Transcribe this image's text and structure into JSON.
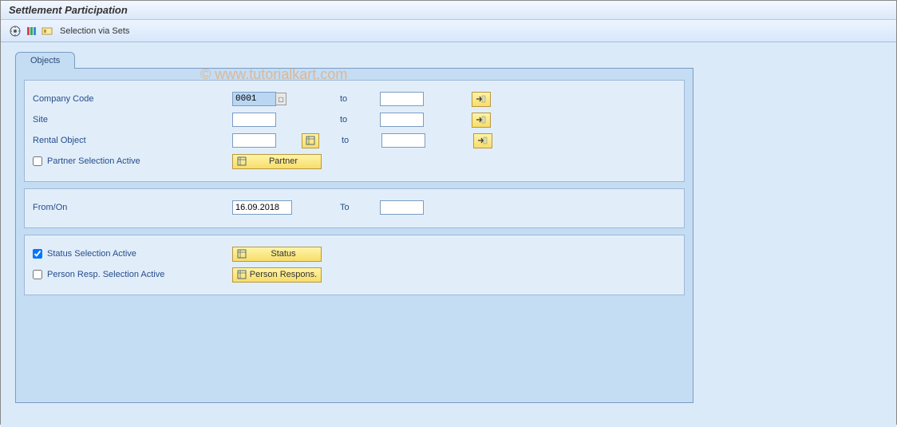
{
  "title": "Settlement Participation",
  "watermark": "© www.tutorialkart.com",
  "toolbar": {
    "selection_via_sets": "Selection via Sets"
  },
  "tabs": {
    "objects": "Objects"
  },
  "fields": {
    "company_code": {
      "label": "Company Code",
      "value": "0001",
      "to_label": "to",
      "to_value": ""
    },
    "site": {
      "label": "Site",
      "value": "",
      "to_label": "to",
      "to_value": ""
    },
    "rental_object": {
      "label": "Rental Object",
      "value": "",
      "to_label": "to",
      "to_value": ""
    },
    "partner_sel": {
      "label": "Partner Selection Active",
      "checked": false
    },
    "partner_btn": "Partner",
    "from_on": {
      "label": "From/On",
      "value": "16.09.2018",
      "to_label": "To",
      "to_value": ""
    },
    "status_sel": {
      "label": "Status Selection Active",
      "checked": true
    },
    "status_btn": "Status",
    "person_resp_sel": {
      "label": "Person Resp. Selection Active",
      "checked": false
    },
    "person_resp_btn": "Person Respons."
  }
}
